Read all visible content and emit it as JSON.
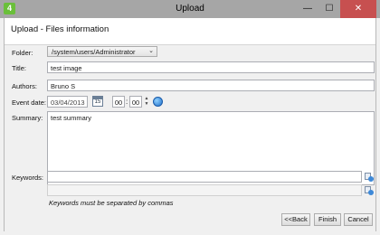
{
  "window": {
    "title": "Upload",
    "app_icon_label": "4",
    "minimize": "—",
    "maximize": "☐",
    "close": "✕"
  },
  "header": {
    "title": "Upload - Files information"
  },
  "form": {
    "folder_label": "Folder:",
    "folder_value": "/system/users/Administrator",
    "folder_chevron": "⌄",
    "title_label": "Title:",
    "title_value": "test image",
    "authors_label": "Authors:",
    "authors_value": "Bruno S",
    "event_date_label": "Event date:",
    "event_date_value": "03/04/2013",
    "calendar_day": "15",
    "hour": "00",
    "minute": "00",
    "time_separator": ":",
    "spin_up": "▲",
    "spin_down": "▼",
    "summary_label": "Summary:",
    "summary_value": "test summary",
    "keywords_label": "Keywords:",
    "keywords_value": "",
    "keywords_secondary_value": "",
    "keywords_hint": "Keywords must be separated by commas"
  },
  "buttons": {
    "back": "<<Back",
    "finish": "Finish",
    "cancel": "Cancel"
  },
  "icons": {
    "calendar": "calendar-icon",
    "globe": "globe-icon",
    "keyword_lookup": "keyword-lookup-icon"
  }
}
